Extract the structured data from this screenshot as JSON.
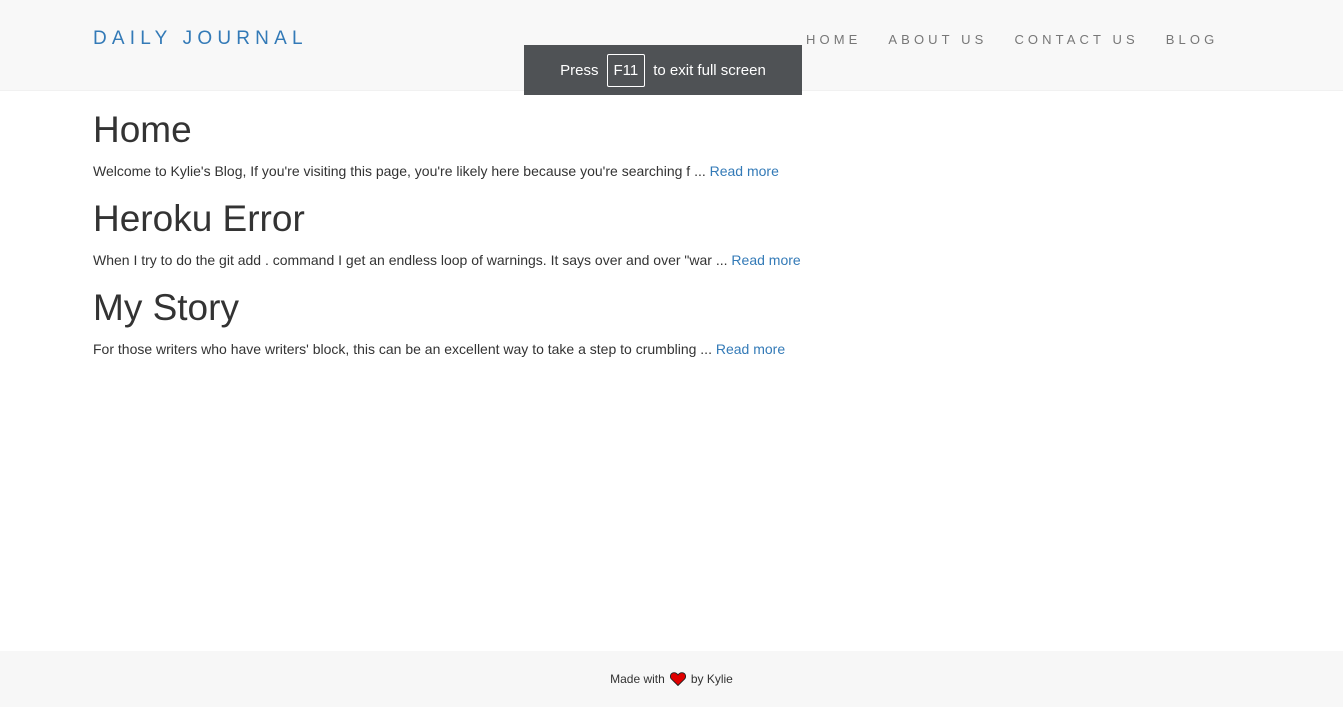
{
  "navbar": {
    "brand": "DAILY JOURNAL",
    "links": [
      {
        "label": "HOME"
      },
      {
        "label": "ABOUT US"
      },
      {
        "label": "CONTACT US"
      },
      {
        "label": "BLOG"
      }
    ]
  },
  "fullscreen_notice": {
    "prefix": "Press",
    "key": "F11",
    "suffix": "to exit full screen"
  },
  "posts": [
    {
      "title": "Home",
      "excerpt": "Welcome to Kylie's Blog, If you're visiting this page, you're likely here because you're searching f ...",
      "link_label": "Read more"
    },
    {
      "title": "Heroku Error",
      "excerpt": "When I try to do the git add . command I get an endless loop of warnings. It says over and over \"war ...",
      "link_label": "Read more"
    },
    {
      "title": "My Story",
      "excerpt": "For those writers who have writers' block, this can be an excellent way to take a step to crumbling ...",
      "link_label": "Read more"
    }
  ],
  "footer": {
    "prefix": "Made with",
    "icon": "heart-icon",
    "suffix": "by Kylie"
  },
  "colors": {
    "brand": "#337ab7",
    "link": "#337ab7",
    "heart": "#e00000"
  }
}
